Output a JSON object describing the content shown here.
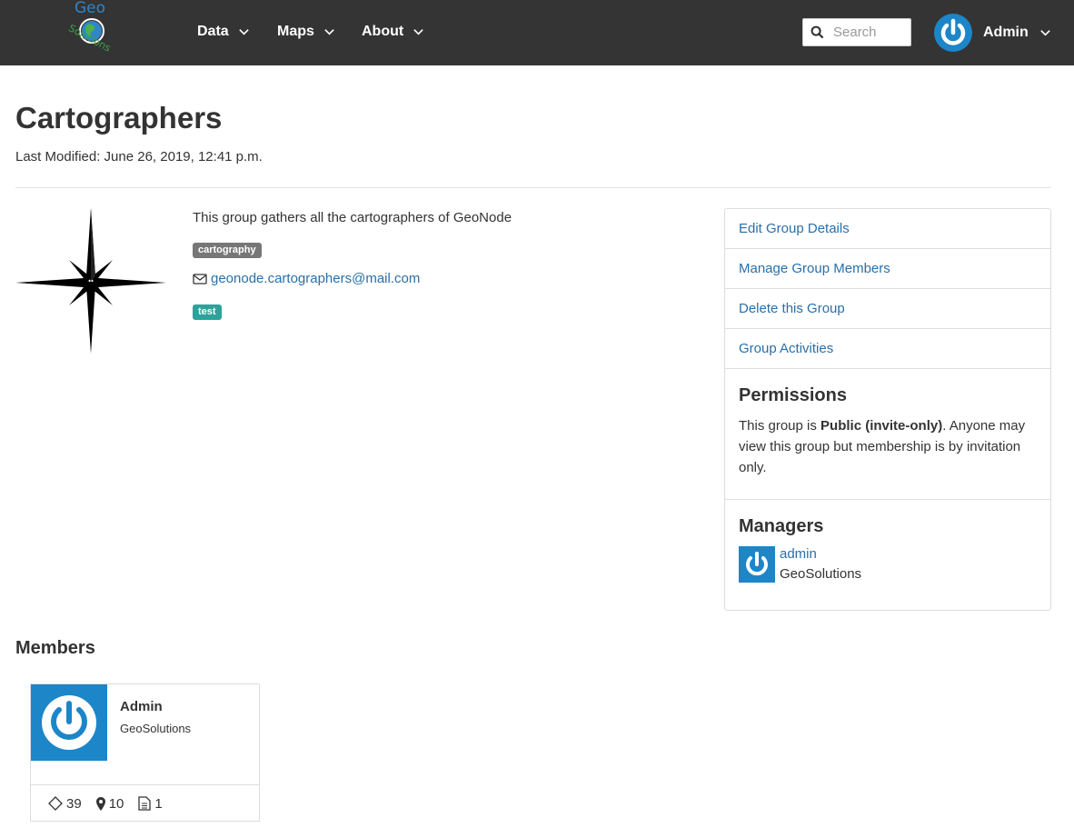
{
  "brand": {
    "logo_text_top": "Geo",
    "logo_text_bottom": "Solutions"
  },
  "nav": {
    "items": [
      {
        "label": "Data"
      },
      {
        "label": "Maps"
      },
      {
        "label": "About"
      }
    ],
    "search_placeholder": "Search",
    "user_label": "Admin"
  },
  "group": {
    "title": "Cartographers",
    "last_modified": "Last Modified: June 26, 2019, 12:41 p.m.",
    "description": "This group gathers all the cartographers of GeoNode",
    "keyword": "cartography",
    "email": "geonode.cartographers@mail.com",
    "category": "test"
  },
  "sidebar": {
    "links": [
      {
        "label": "Edit Group Details"
      },
      {
        "label": "Manage Group Members"
      },
      {
        "label": "Delete this Group"
      },
      {
        "label": "Group Activities"
      }
    ],
    "permissions_title": "Permissions",
    "permissions_prefix": "This group is ",
    "permissions_status": "Public (invite-only)",
    "permissions_suffix": ". Anyone may view this group but membership is by invitation only.",
    "managers_title": "Managers",
    "manager_name": "admin",
    "manager_org": "GeoSolutions"
  },
  "members": {
    "title": "Members",
    "list": [
      {
        "name": "Admin",
        "org": "GeoSolutions",
        "layers": "39",
        "maps": "10",
        "documents": "1"
      }
    ]
  },
  "colors": {
    "navbar": "#343434",
    "link": "#2a6fa8",
    "avatar_blue": "#1c86c8",
    "tag_gray": "#777777",
    "tag_teal": "#2ba39b"
  }
}
